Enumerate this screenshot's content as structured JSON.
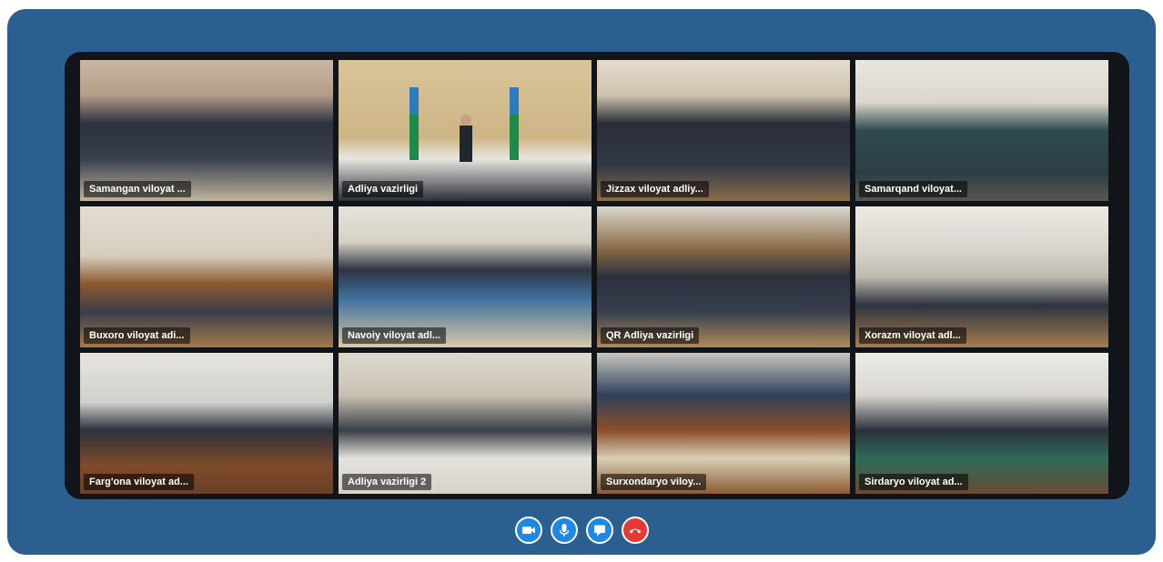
{
  "tiles": [
    {
      "label": "Samangan viloyat ..."
    },
    {
      "label": "Adliya vazirligi"
    },
    {
      "label": "Jizzax viloyat adliy..."
    },
    {
      "label": "Samarqand viloyat..."
    },
    {
      "label": "Buxoro viloyat adi..."
    },
    {
      "label": "Navoiy viloyat adl..."
    },
    {
      "label": "QR Adliya vazirligi"
    },
    {
      "label": "Xorazm viloyat adl..."
    },
    {
      "label": "Farg'ona viloyat ad..."
    },
    {
      "label": "Adliya vazirligi 2"
    },
    {
      "label": "Surxondaryo viloy..."
    },
    {
      "label": "Sirdaryo viloyat ad..."
    }
  ],
  "active_tile_index": 1,
  "controls": {
    "camera": "video-camera-icon",
    "microphone": "microphone-icon",
    "chat": "chat-bubble-icon",
    "end_call": "end-call-icon"
  },
  "colors": {
    "frame": "#2a5f8f",
    "panel": "#111418",
    "active_border": "#3aa146",
    "button": "#1e88e5",
    "end_button": "#e53935"
  }
}
